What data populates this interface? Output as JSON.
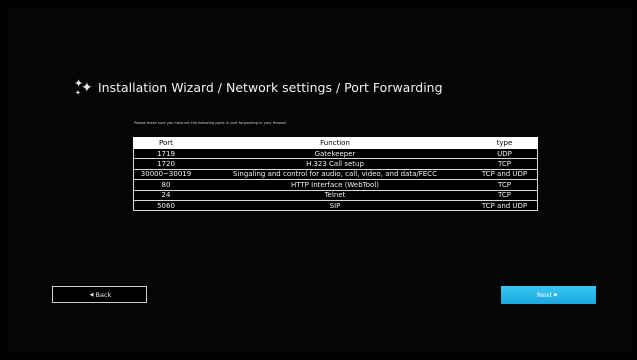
{
  "header": {
    "title": "Installation Wizard / Network settings / Port Forwarding"
  },
  "instruction": "Please make sure you have set the following ports in port forwarding in your firewall.",
  "table": {
    "headers": [
      "Port",
      "Function",
      "type"
    ],
    "rows": [
      [
        "1719",
        "Gatekeeper",
        "UDP"
      ],
      [
        "1720",
        "H.323 Call setup",
        "TCP"
      ],
      [
        "30000~30019",
        "Singaling and control for audio, call, video, and data/FECC",
        "TCP and UDP"
      ],
      [
        "80",
        "HTTP Interface (WebTool)",
        "TCP"
      ],
      [
        "24",
        "Telnet",
        "TCP"
      ],
      [
        "5060",
        "SIP",
        "TCP and UDP"
      ]
    ]
  },
  "buttons": {
    "back_label": "Back",
    "next_label": "Next"
  },
  "colors": {
    "next_button": "#2bb8ee",
    "background": "#000000"
  }
}
